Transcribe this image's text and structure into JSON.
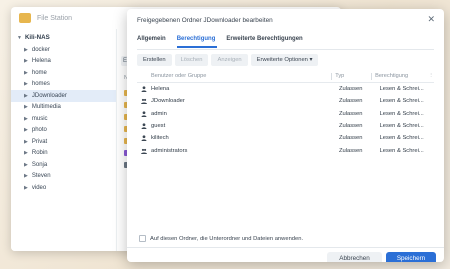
{
  "file_station": {
    "title": "File Station",
    "root": "Kili-NAS",
    "tree": [
      "docker",
      "Helena",
      "home",
      "homes",
      "JDownloader",
      "Multimedia",
      "music",
      "photo",
      "Privat",
      "Robin",
      "Sonja",
      "Steven",
      "video"
    ],
    "selected_index": 4,
    "partial_button": "Er",
    "partial_column": "Nar"
  },
  "dialog": {
    "title": "Freigegebenen Ordner JDownloader bearbeiten",
    "tabs": [
      "Allgemein",
      "Berechtigung",
      "Erweiterte Berechtigungen"
    ],
    "active_tab": 1,
    "toolbar": {
      "create": "Erstellen",
      "delete": "Löschen",
      "view": "Anzeigen",
      "advanced": "Erweiterte Optionen ▾"
    },
    "columns": [
      "Benutzer oder Gruppe",
      "Typ",
      "Berechtigung"
    ],
    "rows": [
      {
        "name": "Helena",
        "icon": "user-icon",
        "type": "Zulassen",
        "perm": "Lesen & Schrei..."
      },
      {
        "name": "JDownloader",
        "icon": "group-icon",
        "type": "Zulassen",
        "perm": "Lesen & Schrei..."
      },
      {
        "name": "admin",
        "icon": "user-icon",
        "type": "Zulassen",
        "perm": "Lesen & Schrei..."
      },
      {
        "name": "guest",
        "icon": "user-icon",
        "type": "Zulassen",
        "perm": "Lesen & Schrei..."
      },
      {
        "name": "kilitech",
        "icon": "user-icon",
        "type": "Zulassen",
        "perm": "Lesen & Schrei..."
      },
      {
        "name": "administrators",
        "icon": "group-icon",
        "type": "Zulassen",
        "perm": "Lesen & Schrei..."
      }
    ],
    "apply_label": "Auf diesen Ordner, die Unterordner und Dateien anwenden.",
    "cancel": "Abbrechen",
    "save": "Speichern",
    "colors": {
      "accent": "#2b6fd6",
      "folder": "#e7b64e"
    }
  }
}
